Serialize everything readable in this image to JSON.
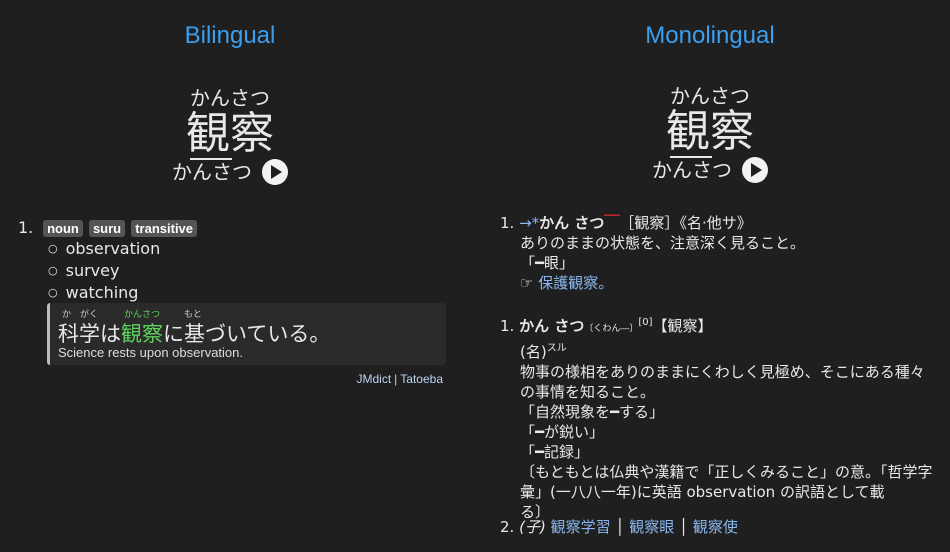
{
  "bilingual": {
    "heading": "Bilingual",
    "reading": "かんさつ",
    "kanji": "観察",
    "pitch": "かんさつ",
    "sense_num": "1.",
    "tags": [
      "noun",
      "suru",
      "transitive"
    ],
    "glosses": [
      "observation",
      "survey",
      "watching"
    ],
    "example": {
      "furigana": [
        "か",
        "がく",
        "かんさつ",
        "もと"
      ],
      "jp_before": "科学は",
      "jp_highlight": "観察",
      "jp_after": "に基づいている。",
      "en": "Science rests upon observation."
    },
    "source_a": "JMdict",
    "source_b": "Tatoeba"
  },
  "monolingual": {
    "heading": "Monolingual",
    "reading": "かんさつ",
    "kanji": "観察",
    "pitch": "かんさつ",
    "e1": {
      "num": "1.",
      "arrow": "→*",
      "head": "かん さつ",
      "bracket": "［観察］",
      "pos": "《名·他サ》",
      "def": "ありのままの状態を、注意深く見ること。",
      "ex": "「━眼」",
      "ref_mark": "☞",
      "ref": "保護観察。"
    },
    "e2": {
      "num": "1.",
      "head": "かん さつ",
      "kana_small": "〔くわん―〕",
      "accent": "[0]",
      "bracket": "【観察】",
      "pos": "(名)",
      "suru": "スル",
      "def1": "物事の様相をありのままにくわしく見極め、そこにある種々",
      "def2": "の事情を知ること。",
      "ex1": "「自然現象を━する」",
      "ex2": "「━が鋭い」",
      "ex3": "「━記録」",
      "note1": "〔もともとは仏典や漢籍で「正しくみること」の意。「哲学字",
      "note2": "彙」(一八八一年)に英語 observation の訳語として載",
      "note3": "る〕"
    },
    "e3": {
      "num": "2.",
      "kanji_mark": "(子)",
      "links": [
        "観察学習",
        "観察眼",
        "観察使"
      ]
    }
  }
}
